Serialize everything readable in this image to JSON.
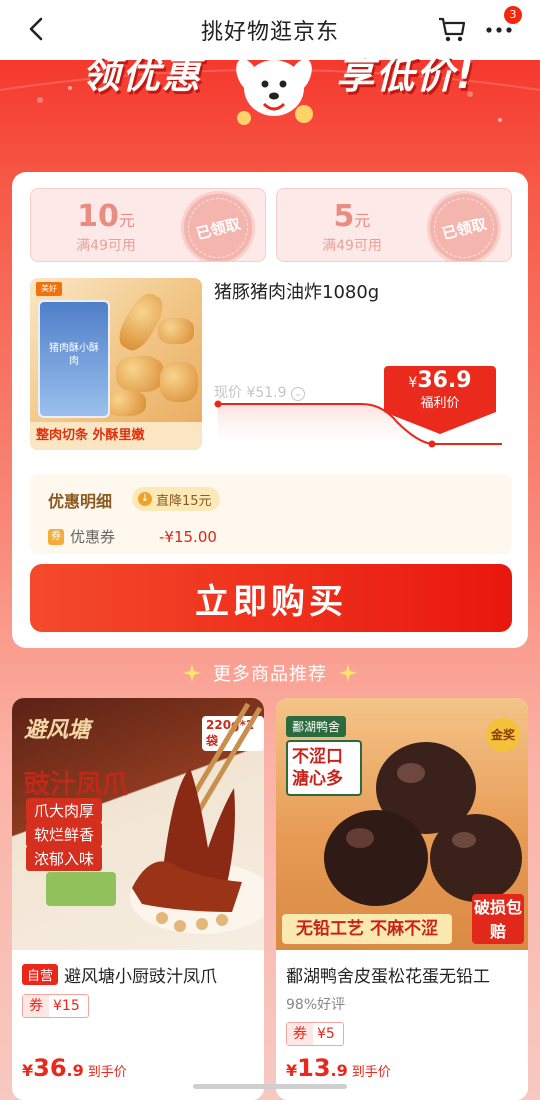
{
  "header": {
    "title": "挑好物逛京东",
    "badge_count": "3"
  },
  "banner": {
    "left_text": "领优惠",
    "right_text": "享低价!"
  },
  "coupons": [
    {
      "amount": "10",
      "unit": "元",
      "condition": "满49可用",
      "stamp": "已领取"
    },
    {
      "amount": "5",
      "unit": "元",
      "condition": "满49可用",
      "stamp": "已领取"
    }
  ],
  "product": {
    "name": "猪豚猪肉油炸1080g",
    "image_brand": "美好",
    "image_bag_text": "猪肉酥小酥肉",
    "image_slogan": "整肉切条 外酥里嫩",
    "current_price_label": "现价",
    "current_price": "¥51.9",
    "deal_price_yen": "¥",
    "deal_price": "36.9",
    "deal_label": "福利价"
  },
  "discount": {
    "title": "优惠明细",
    "chip": "直降15元",
    "row_label": "优惠券",
    "row_icon_text": "券",
    "row_value": "-¥15.00"
  },
  "buy_button": {
    "label": "立即购买"
  },
  "recommend": {
    "title": "更多商品推荐",
    "items": [
      {
        "self_badge": "自营",
        "name": "避风塘小厨豉汁凤爪",
        "rating": "",
        "coupon_key": "券",
        "coupon_value": "¥15",
        "price_yen": "¥",
        "price_int": "36",
        "price_dec": ".9",
        "price_label": "到手价",
        "img_brand": "避风塘",
        "img_title": "豉汁凤爪",
        "img_tags": [
          "爪大肉厚",
          "软烂鲜香",
          "浓郁入味"
        ],
        "img_spec": "220g*2袋"
      },
      {
        "self_badge": "",
        "name": "鄱湖鸭舍皮蛋松花蛋无铅工",
        "rating": "98%好评",
        "coupon_key": "券",
        "coupon_value": "¥5",
        "price_yen": "¥",
        "price_int": "13",
        "price_dec": ".9",
        "price_label": "到手价",
        "img_brand": "鄱湖鸭舍",
        "img_slogan": "不涩口 溏心多",
        "img_bottom": "无铅工艺 不麻不涩",
        "img_badge": "破损包赔",
        "img_award": "金奖"
      }
    ]
  },
  "colors": {
    "accent": "#e9271b",
    "hero_top": "#f5382e",
    "coupon_bg": "#fde9e7"
  }
}
